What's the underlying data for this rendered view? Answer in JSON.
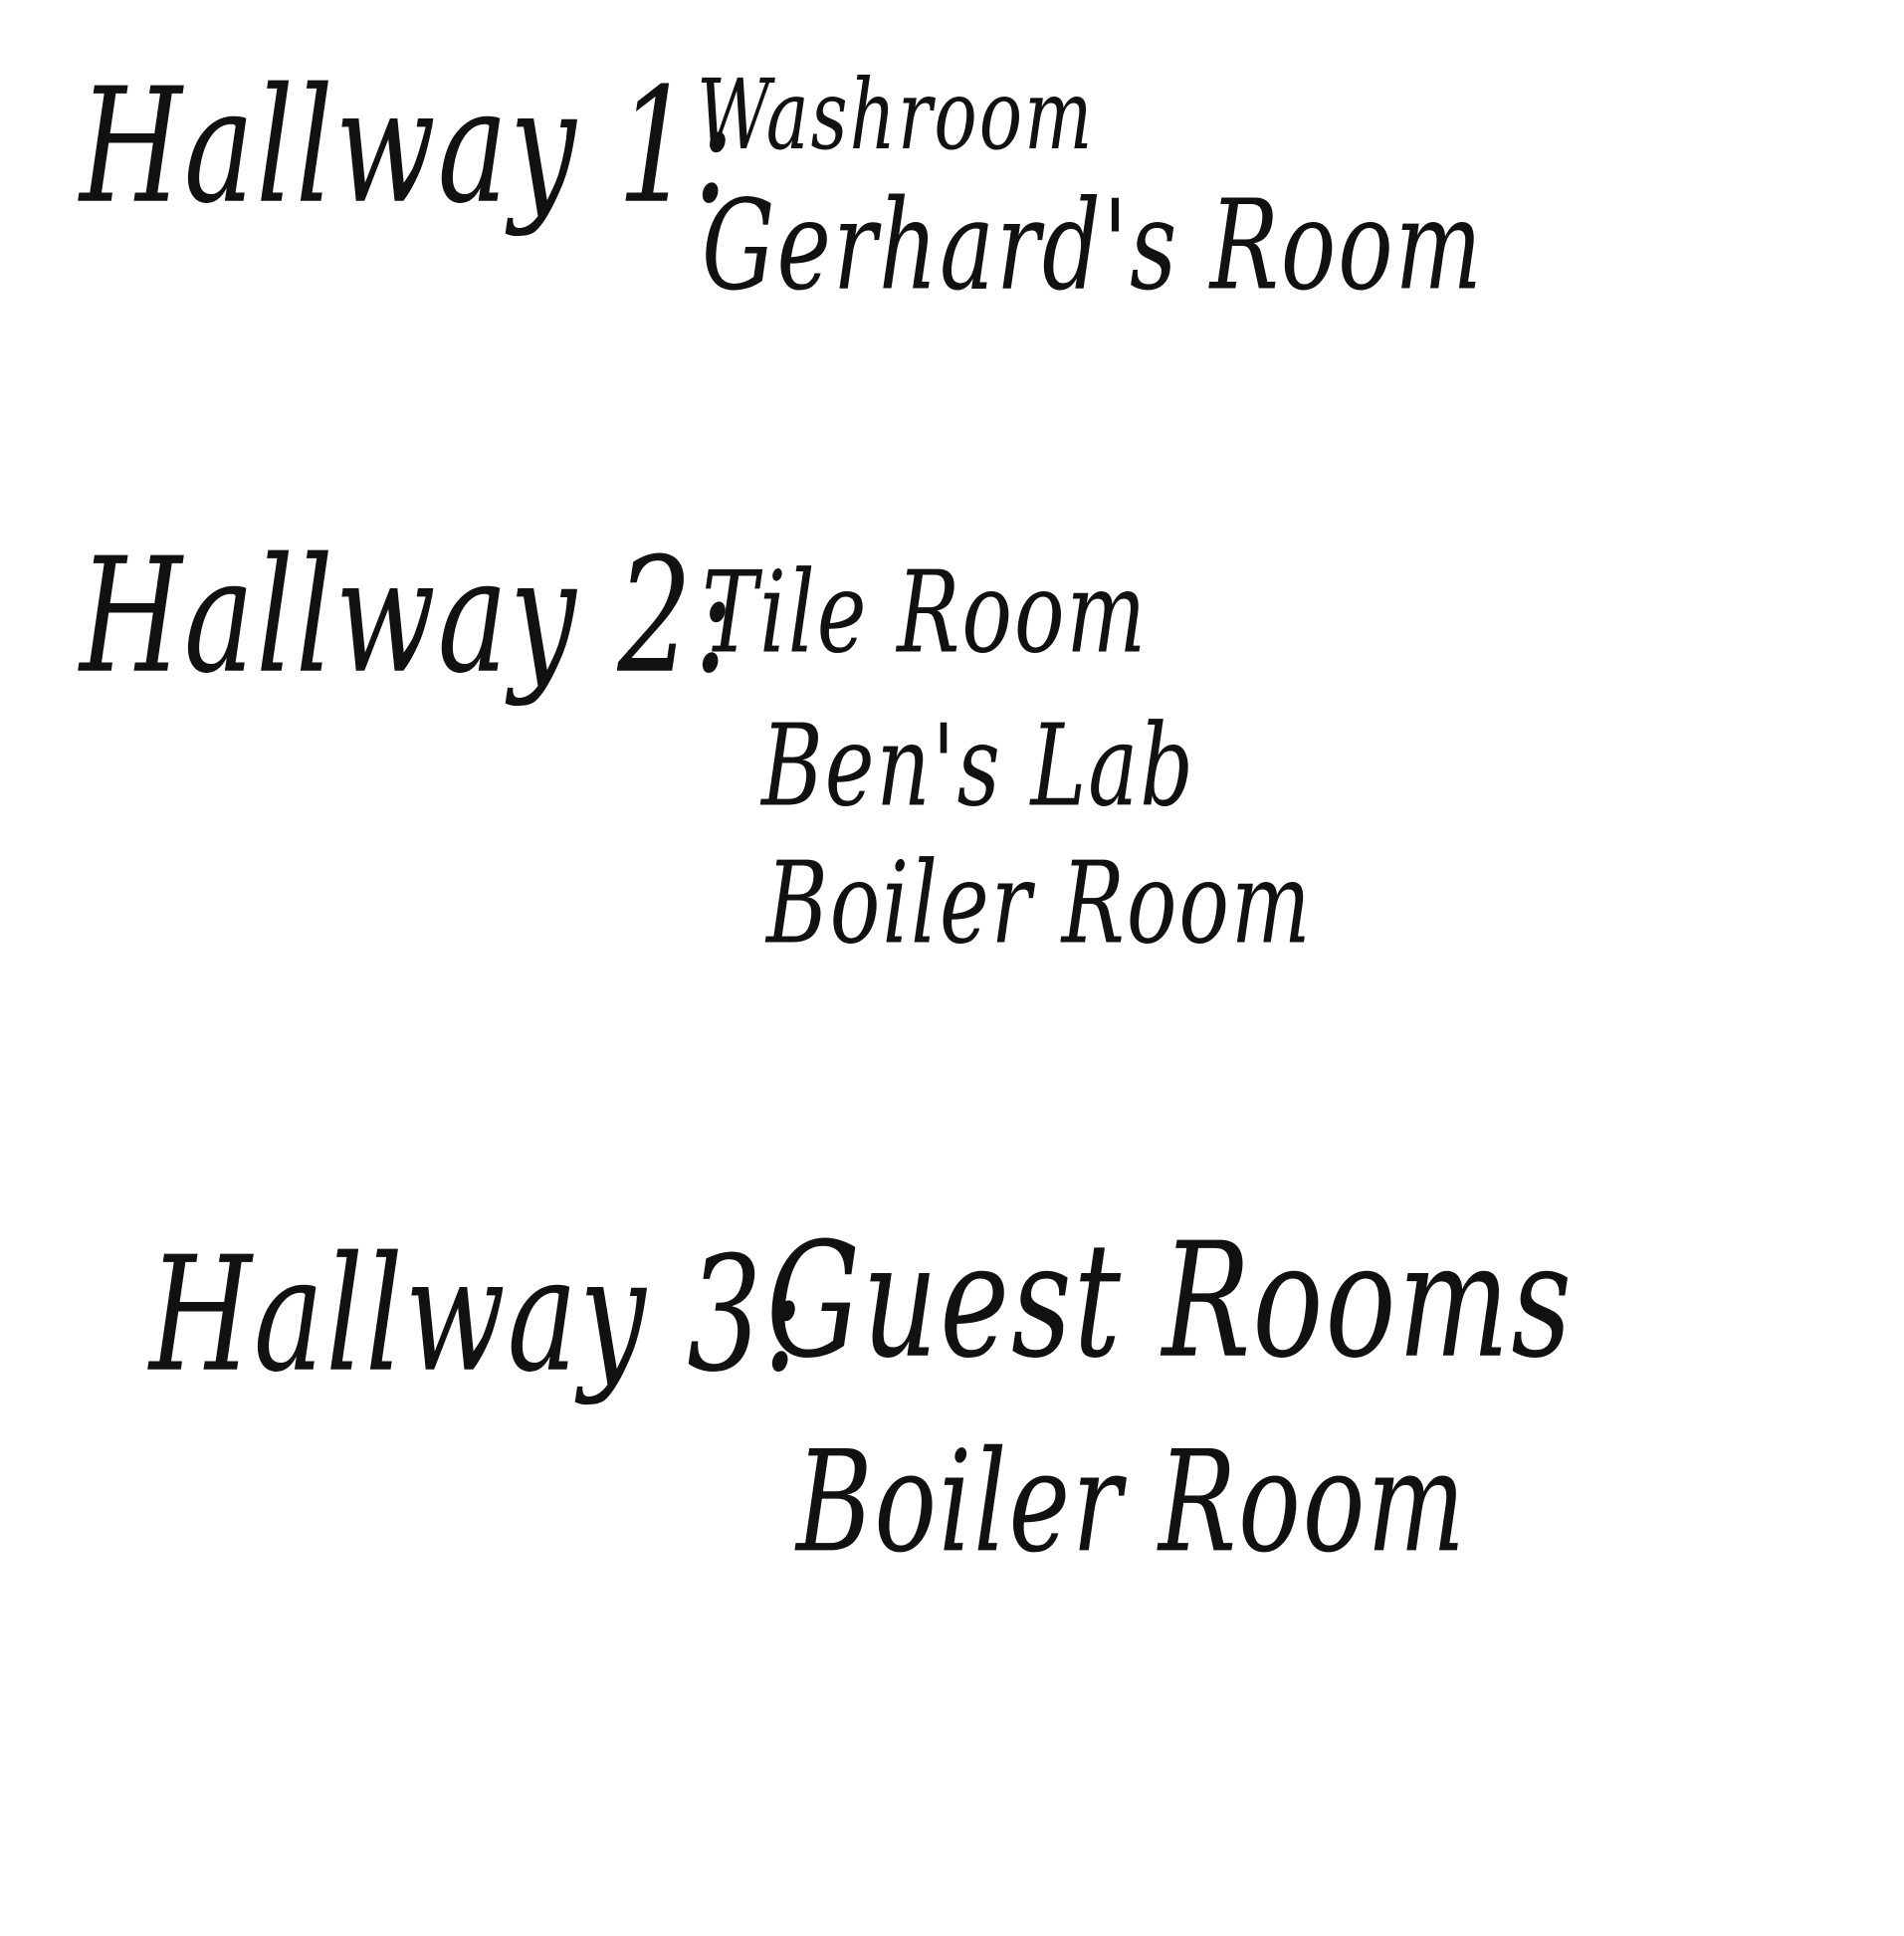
{
  "ink_color": "#111111",
  "background_color": "#ffffff",
  "hallways": [
    {
      "label": "Hallway 1:",
      "rooms": [
        "Washroom",
        "Gerhard's Room"
      ]
    },
    {
      "label": "Hallway 2:",
      "rooms": [
        "Tile Room",
        "Ben's Lab",
        "Boiler Room"
      ]
    },
    {
      "label": "Hallway 3:",
      "rooms": [
        "Guest Rooms",
        "Boiler Room"
      ]
    }
  ]
}
